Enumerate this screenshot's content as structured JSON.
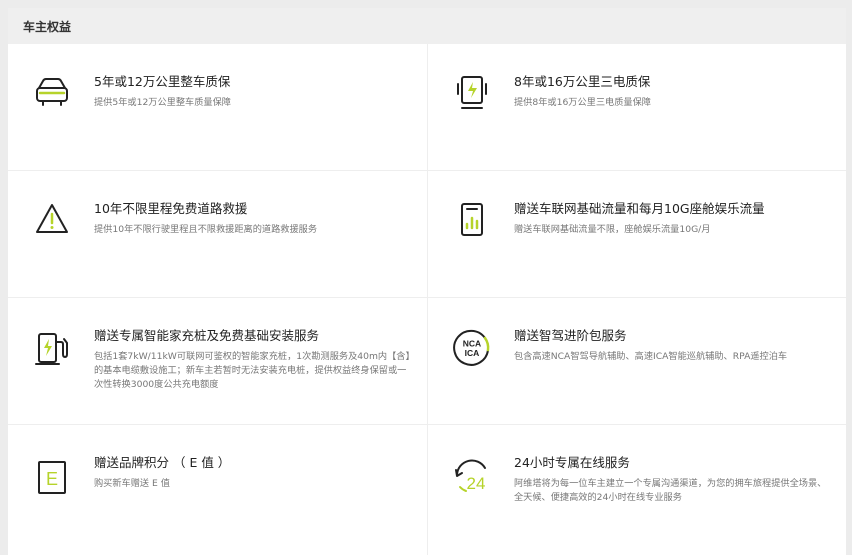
{
  "header": {
    "title": "车主权益"
  },
  "benefits": [
    {
      "icon": "car-icon",
      "title": "5年或12万公里整车质保",
      "desc": "提供5年或12万公里整车质量保障"
    },
    {
      "icon": "battery-electric-icon",
      "title": "8年或16万公里三电质保",
      "desc": "提供8年或16万公里三电质量保障"
    },
    {
      "icon": "warning-triangle-icon",
      "title": "10年不限里程免费道路救援",
      "desc": "提供10年不限行驶里程且不限救援距离的道路救援服务"
    },
    {
      "icon": "phone-data-icon",
      "title": "赠送车联网基础流量和每月10G座舱娱乐流量",
      "desc": "赠送车联网基础流量不限，座舱娱乐流量10G/月"
    },
    {
      "icon": "charging-pile-icon",
      "title": "赠送专属智能家充桩及免费基础安装服务",
      "desc": "包括1套7kW/11kW可联网可鉴权的智能家充桩，1次勘测服务及40m内【含】的基本电缆敷设施工；新车主若暂时无法安装充电桩，提供权益终身保留或一次性转换3000度公共充电额度"
    },
    {
      "icon": "nca-ica-icon",
      "title": "赠送智驾进阶包服务",
      "desc": "包含高速NCA智驾导航辅助、高速ICA智能巡航辅助、RPA遥控泊车",
      "icon_text_top": "NCA",
      "icon_text_bottom": "ICA"
    },
    {
      "icon": "e-points-icon",
      "title": "赠送品牌积分 （ E 值 ）",
      "desc": "购买新车赠送 E 值",
      "icon_text": "E"
    },
    {
      "icon": "24h-service-icon",
      "title": "24小时专属在线服务",
      "desc": "阿维塔将为每一位车主建立一个专属沟通渠道，为您的拥车旅程提供全场景、全天候、便捷高效的24小时在线专业服务",
      "icon_text": "24"
    }
  ],
  "colors": {
    "accent": "#b6d32a",
    "icon_stroke": "#222222"
  }
}
